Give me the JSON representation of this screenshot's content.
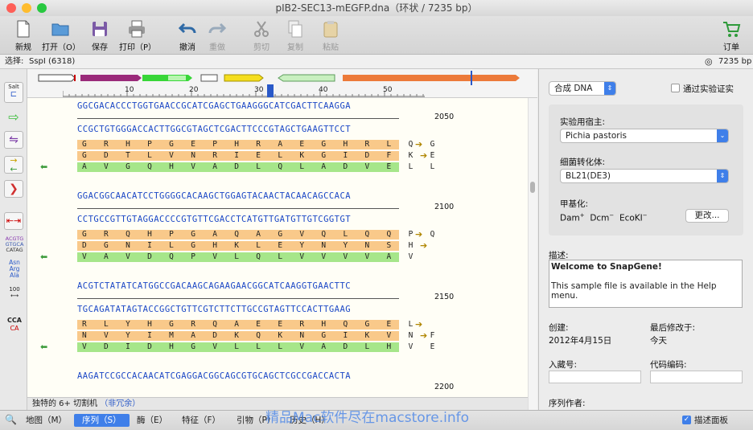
{
  "window": {
    "title": "pIB2-SEC13-mEGFP.dna（环状 / 7235 bp）"
  },
  "toolbar": {
    "new": "新规",
    "open": "打开（O）",
    "save": "保存",
    "print": "打印（P）",
    "undo": "撤消",
    "redo": "重做",
    "cut": "剪切",
    "copy": "复制",
    "paste": "粘贴",
    "order": "订单"
  },
  "selection": {
    "label": "选择:",
    "value": "SspI (6318)",
    "length": "7235 bp"
  },
  "ruler": {
    "ticks": [
      "10",
      "20",
      "30",
      "40",
      "50"
    ]
  },
  "left_tools": {
    "salt": "Salt",
    "acgtg": "ACGTG",
    "gtgca": "GTGCA",
    "catag": "CATAG",
    "asn": "Asn",
    "arg": "Arg",
    "ala": "Ala",
    "hundred": "100",
    "cca": "CCA",
    "ca": "CA"
  },
  "blocks": [
    {
      "pos": "2050",
      "top": "GGCGACACCCTGGTGAACCGCATCGAGCTGAAGGGCATCGACTTCAAGGA",
      "bottom": "CCGCTGTGGGACCACTTGGCGTAGCTCGACTTCCCGTAGCTGAAGTTCCT",
      "aa1": "G R H P G E P H R A E G H R L Q G",
      "aa2": "G D T L V N R I E L K G I D F K E",
      "aa3": "A V G Q H V A D L Q L A D V E L L"
    },
    {
      "pos": "2100",
      "top": "GGACGGCAACATCCTGGGGCACAAGCTGGAGTACAACTACAACAGCCACA",
      "bottom": "CCTGCCGTTGTAGGACCCCGTGTTCGACCTCATGTTGATGTTGTCGGTGT",
      "aa1": "G R Q H P G A Q A G V Q L Q Q P Q",
      "aa2": "D G N I L G H K L E Y N Y N S H",
      "aa3": "V A V D Q P V L Q L V V V V A V"
    },
    {
      "pos": "2150",
      "top": "ACGTCTATATCATGGCCGACAAGCAGAAGAACGGCATCAAGGTGAACTTC",
      "bottom": "TGCAGATATAGTACCGGCTGTTCGTCTTCTTGCCGTAGTTCCACTTGAAG",
      "aa1": "R L Y H G R Q A E E R H Q G E L",
      "aa2": "N V Y I M A D K Q K N G I K V N F",
      "aa3": "V D I D H G V L L L V A D L H V E"
    },
    {
      "pos": "2200",
      "top": "AAGATCCGCCACAACATCGAGGACGGCAGCGTGCAGCTCGCCGACCACTA",
      "bottom": "",
      "aa1": "",
      "aa2": "",
      "aa3": ""
    }
  ],
  "bottom_segment": {
    "label": "独特的 6+ 切割机",
    "link": "（非冗余）"
  },
  "right_panel": {
    "synth": "合成 DNA",
    "verified": "通过实验证实",
    "host_label": "实验用宿主:",
    "host_value": "Pichia pastoris",
    "strain_label": "细菌转化体:",
    "strain_value": "BL21(DE3)",
    "methyl_label": "甲基化:",
    "dam": "Dam",
    "dcm": "Dcm",
    "ecoki": "EcoKI",
    "dam_sup": "+",
    "dcm_sup": "−",
    "ecoki_sup": "−",
    "change_button": "更改...",
    "desc_label": "描述:",
    "desc_title": "Welcome to SnapGene!",
    "desc_body": "This sample file is available in the Help menu.",
    "created_label": "创建:",
    "created_value": "2012年4月15日",
    "modified_label": "最后修改于:",
    "modified_value": "今天",
    "accession_label": "入藏号:",
    "code_label": "代码编码:",
    "authors_label": "序列作者:"
  },
  "tabs": [
    "地图（M）",
    "序列（S）",
    "酶（E）",
    "特征（F）",
    "引物（P）",
    "历史（H）"
  ],
  "desc_panel_toggle": "描述面板",
  "watermark": "精品Mac软件尽在macstore.info",
  "colors": {
    "accent": "#3f7fe9",
    "dna": "#1b47c6",
    "aa_orange": "#f9c98a",
    "aa_green": "#a6e68a"
  }
}
